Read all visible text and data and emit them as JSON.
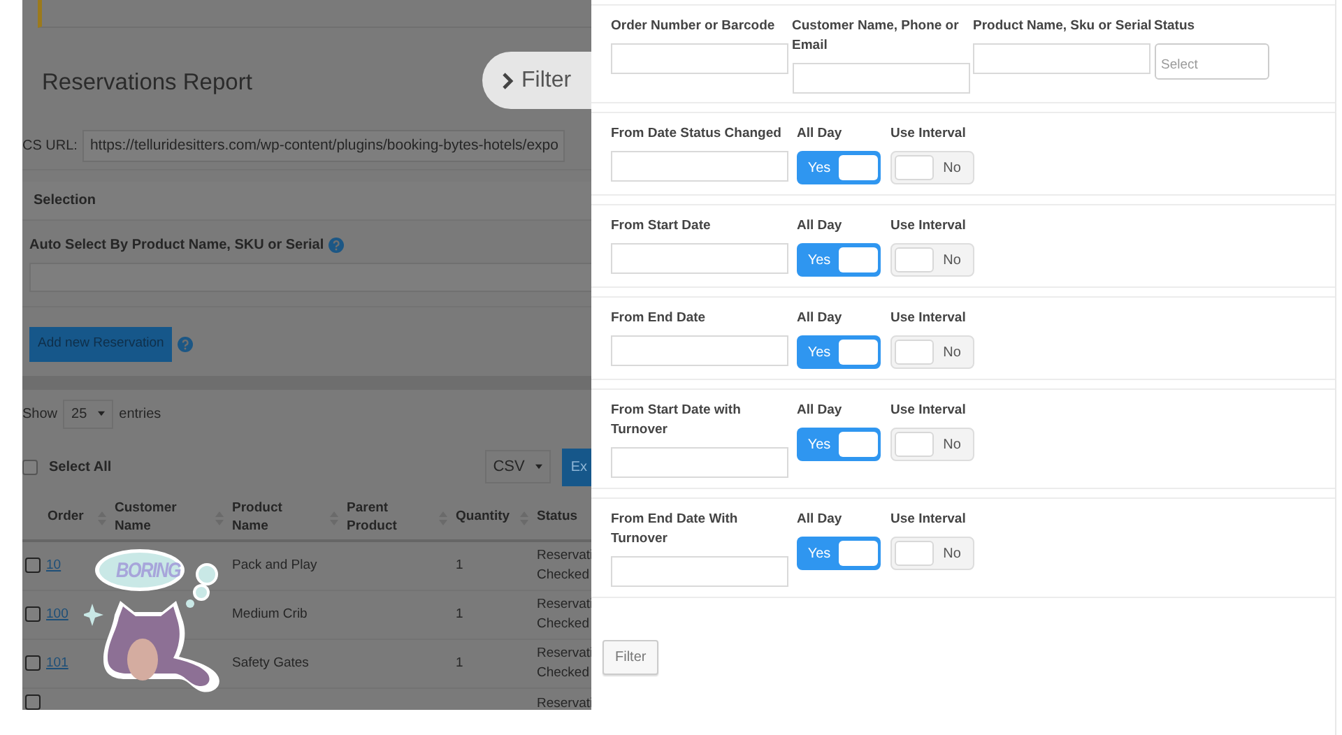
{
  "background_page": {
    "title": "Reservations Report",
    "ics_url": {
      "label": "CS URL:",
      "value": "https://telluridesitters.com/wp-content/plugins/booking-bytes-hotels/expo"
    },
    "selection_heading": "Selection",
    "auto_select_label": "Auto Select By Product Name, SKU or Serial",
    "add_button": "Add new Reservation",
    "show_entries": {
      "before": "Show",
      "value": "25",
      "after": "entries"
    },
    "select_all": {
      "label": "Select All",
      "checked": false
    },
    "export_format": "CSV",
    "export_button": "Ex",
    "table": {
      "columns": [
        "Order",
        "Customer Name",
        "Product Name",
        "Parent Product",
        "Quantity",
        "Status"
      ],
      "rows": [
        {
          "checked": false,
          "order": "10",
          "product": "Pack and Play",
          "quantity": "1",
          "status": [
            "Reservati",
            "Checked"
          ]
        },
        {
          "checked": false,
          "order": "100",
          "product": "Medium Crib",
          "quantity": "1",
          "status": [
            "Reservati",
            "Checked"
          ]
        },
        {
          "checked": false,
          "order": "101",
          "product": "Safety Gates",
          "quantity": "1",
          "status": [
            "Reservati",
            "Checked"
          ]
        },
        {
          "checked": false,
          "status": [
            "Reservati"
          ]
        }
      ]
    }
  },
  "sticker": {
    "text": "BORING"
  },
  "filter_tab": {
    "label": "Filter"
  },
  "filter_panel": {
    "search_fields": [
      {
        "kind": "text",
        "label": "Order Number or Barcode"
      },
      {
        "kind": "text",
        "label": "Customer Name, Phone or Email"
      },
      {
        "kind": "text",
        "label": "Product Name, Sku or Serial"
      },
      {
        "kind": "select",
        "label": "Status",
        "placeholder": "Select"
      }
    ],
    "date_filters": [
      {
        "label": "From Date Status Changed",
        "all_day": {
          "label": "All Day",
          "on": true,
          "text": "Yes"
        },
        "use_interval": {
          "label": "Use Interval",
          "on": false,
          "text": "No"
        }
      },
      {
        "label": "From Start Date",
        "all_day": {
          "label": "All Day",
          "on": true,
          "text": "Yes"
        },
        "use_interval": {
          "label": "Use Interval",
          "on": false,
          "text": "No"
        }
      },
      {
        "label": "From End Date",
        "all_day": {
          "label": "All Day",
          "on": true,
          "text": "Yes"
        },
        "use_interval": {
          "label": "Use Interval",
          "on": false,
          "text": "No"
        }
      },
      {
        "label": "From Start Date with Turnover",
        "all_day": {
          "label": "All Day",
          "on": true,
          "text": "Yes"
        },
        "use_interval": {
          "label": "Use Interval",
          "on": false,
          "text": "No"
        }
      },
      {
        "label": "From End Date With Turnover",
        "all_day": {
          "label": "All Day",
          "on": true,
          "text": "Yes"
        },
        "use_interval": {
          "label": "Use Interval",
          "on": false,
          "text": "No"
        }
      }
    ],
    "filter_button": "Filter"
  }
}
